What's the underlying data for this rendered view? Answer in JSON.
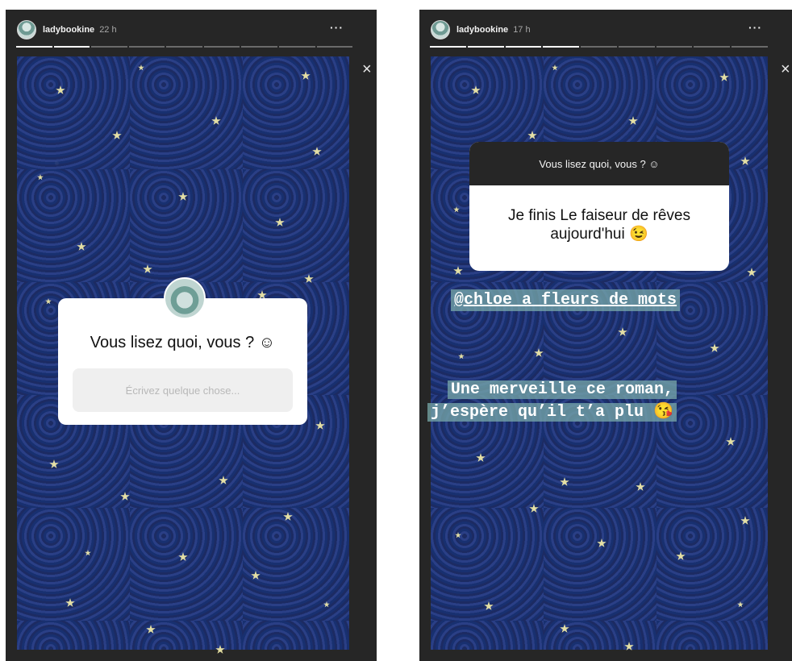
{
  "left": {
    "username": "ladybookine",
    "time": "22 h",
    "more": "···",
    "close": "×",
    "question": "Vous lisez quoi, vous ? ☺",
    "placeholder": "Écrivez quelque chose...",
    "progress_done": 2,
    "progress_total": 9
  },
  "right": {
    "username": "ladybookine",
    "time": "17 h",
    "more": "···",
    "close": "×",
    "question": "Vous lisez quoi, vous ? ☺",
    "answer_line1": "Je finis Le faiseur de rêves",
    "answer_line2": "aujourd'hui 😉",
    "mention": "@chloe_a_fleurs_de_mots",
    "caption_line1": "Une merveille ce roman,",
    "caption_line2": "j’espère qu’il t’a plu 😘",
    "progress_done": 4,
    "progress_total": 9
  }
}
